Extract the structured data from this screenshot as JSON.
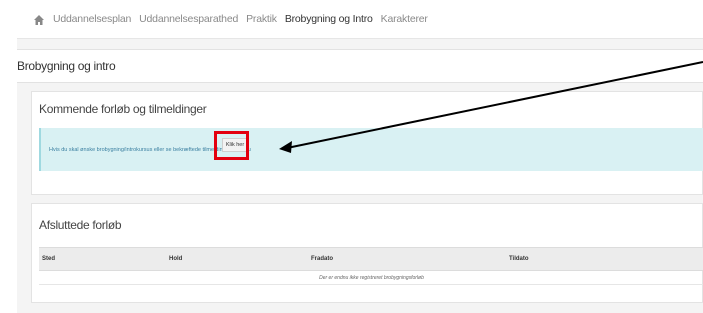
{
  "nav": {
    "items": [
      {
        "label": "Uddannelsesplan",
        "active": false
      },
      {
        "label": "Uddannelsesparathed",
        "active": false
      },
      {
        "label": "Praktik",
        "active": false
      },
      {
        "label": "Brobygning og Intro",
        "active": true
      },
      {
        "label": "Karakterer",
        "active": false
      }
    ]
  },
  "page": {
    "title": "Brobygning og intro"
  },
  "upcoming": {
    "title": "Kommende forløb og tilmeldinger",
    "info_text": "Hvis du skal ønske brobygning/introkursus eller se bekræftede tilmeldinger, skal du",
    "button_label": "Klik her"
  },
  "completed": {
    "title": "Afsluttede forløb",
    "columns": [
      "Sted",
      "Hold",
      "Fradato",
      "Tildato"
    ],
    "empty_message": "Der er endnu ikke registreret brobygningsforløb"
  },
  "colors": {
    "highlight": "#e3000f",
    "info_bg": "#d9f1f3",
    "arrow": "#000000"
  }
}
